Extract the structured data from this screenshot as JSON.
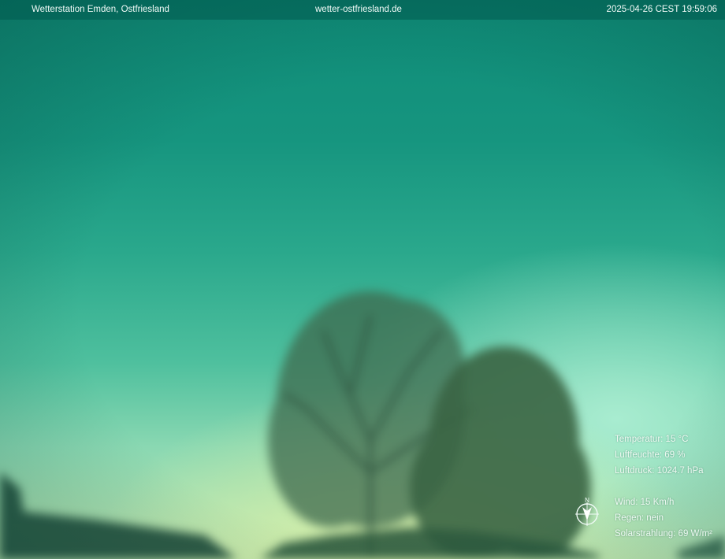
{
  "header": {
    "station": "Wetterstation Emden, Ostfriesland",
    "website": "wetter-ostfriesland.de",
    "timestamp": "2025-04-26 CEST 19:59:06"
  },
  "readings": {
    "temperature": "Temperatur: 15 °C",
    "humidity": "Luftfeuchte: 69 %",
    "pressure": "Luftdruck: 1024.7 hPa",
    "wind": "Wind: 15 Km/h",
    "rain": "Regen: nein",
    "solar": "Solarstrahlung: 69 W/m²"
  },
  "compass": {
    "north_label": "N",
    "icon": "compass-icon"
  },
  "colors": {
    "sky_top": "#0f8c78",
    "sky_horizon": "#c4e8b0",
    "text": "#f2fbf8"
  }
}
